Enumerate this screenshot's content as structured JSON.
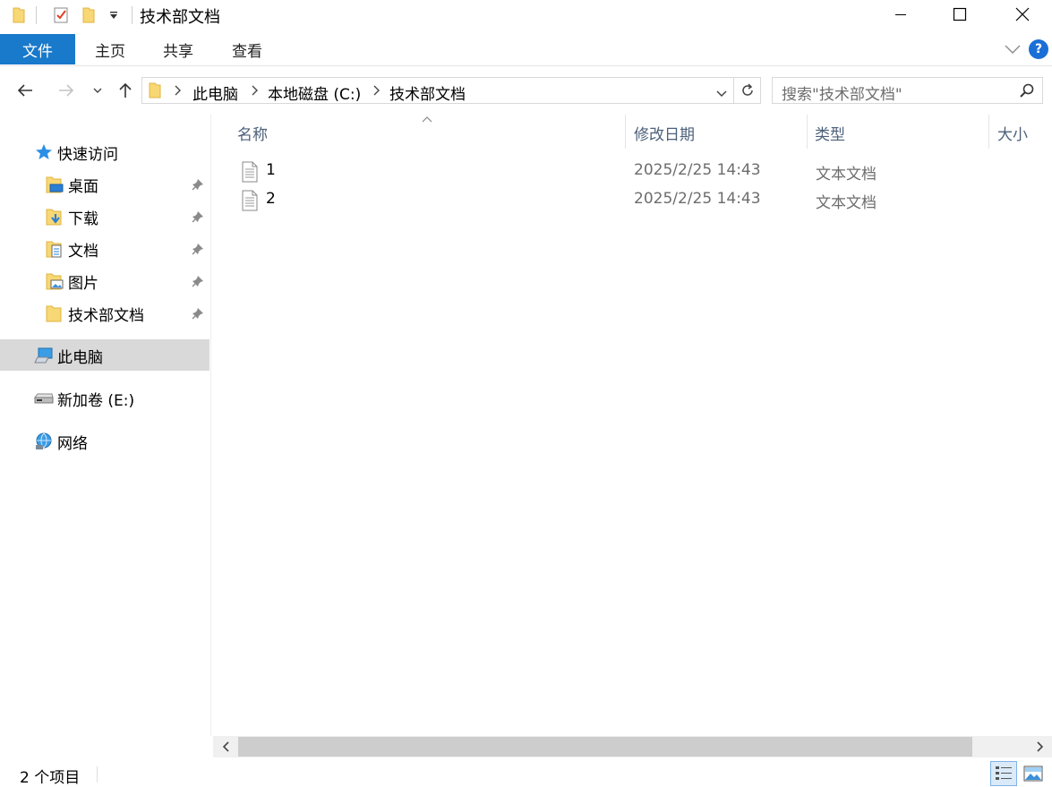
{
  "window": {
    "title": "技术部文档",
    "minimize_label": "最小化",
    "maximize_label": "最大化",
    "close_label": "关闭"
  },
  "ribbon": {
    "tabs": [
      {
        "label": "文件"
      },
      {
        "label": "主页"
      },
      {
        "label": "共享"
      },
      {
        "label": "查看"
      }
    ],
    "help_label": "?"
  },
  "address": {
    "breadcrumbs": [
      "此电脑",
      "本地磁盘 (C:)",
      "技术部文档"
    ]
  },
  "search": {
    "placeholder": "搜索\"技术部文档\""
  },
  "sidebar": {
    "quick_access": "快速访问",
    "quick_items": [
      {
        "label": "桌面",
        "icon": "desktop-folder-icon"
      },
      {
        "label": "下载",
        "icon": "download-folder-icon"
      },
      {
        "label": "文档",
        "icon": "documents-folder-icon"
      },
      {
        "label": "图片",
        "icon": "pictures-folder-icon"
      },
      {
        "label": "技术部文档",
        "icon": "folder-icon"
      }
    ],
    "this_pc": "此电脑",
    "drive": "新加卷 (E:)",
    "network": "网络"
  },
  "columns": {
    "name": "名称",
    "modified": "修改日期",
    "type": "类型",
    "size": "大小"
  },
  "files": [
    {
      "name": "1",
      "modified": "2025/2/25 14:43",
      "type": "文本文档"
    },
    {
      "name": "2",
      "modified": "2025/2/25 14:43",
      "type": "文本文档"
    }
  ],
  "status": {
    "item_count": "2 个项目"
  },
  "colors": {
    "file_tab": "#1979ca",
    "selection": "#d9d9d9",
    "header_text": "#4c607a",
    "folder": "#f5c542"
  }
}
